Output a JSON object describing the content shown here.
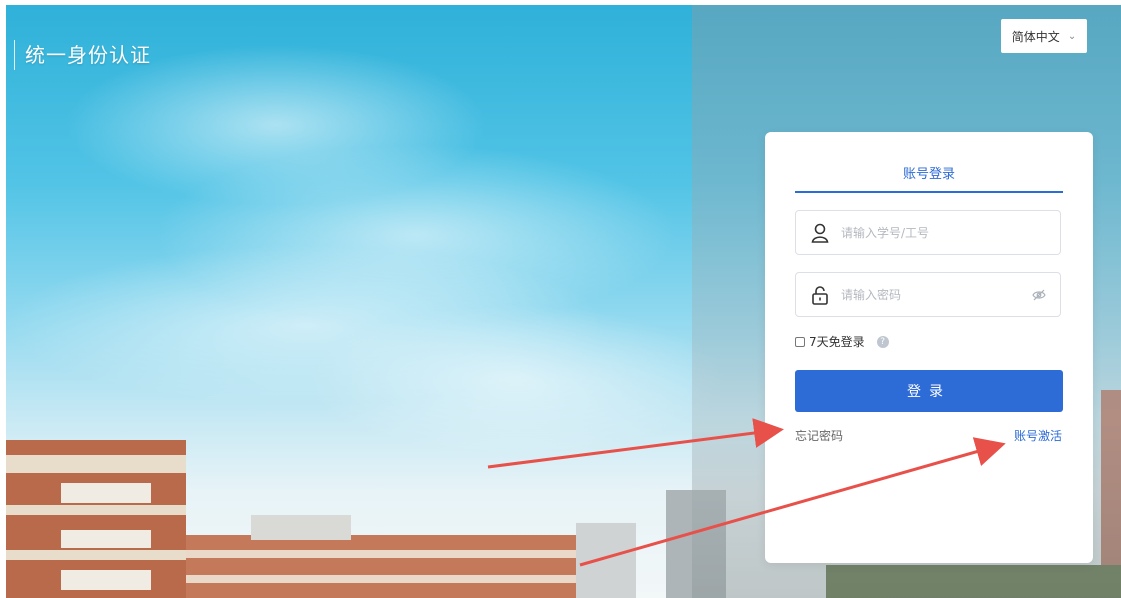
{
  "brand": {
    "title": "统一身份认证"
  },
  "language": {
    "selected": "简体中文"
  },
  "login": {
    "tab_label": "账号登录",
    "username_placeholder": "请输入学号/工号",
    "password_placeholder": "请输入密码",
    "remember_label": "7天免登录",
    "submit_label": "登录",
    "forgot_label": "忘记密码",
    "activate_label": "账号激活"
  },
  "colors": {
    "accent": "#2d6bd6",
    "annotation_arrow": "#e8504a"
  },
  "icons": [
    "user-icon",
    "lock-icon",
    "eye-off-icon",
    "help-icon",
    "chevron-down-icon"
  ]
}
